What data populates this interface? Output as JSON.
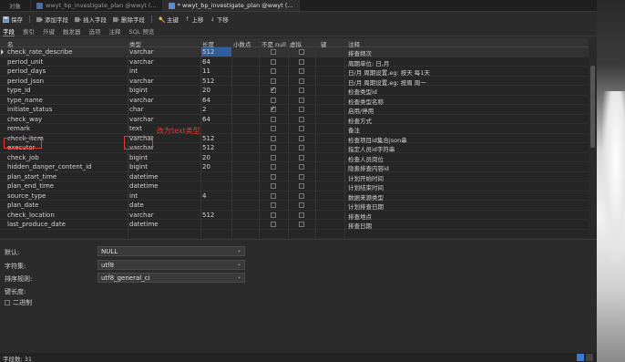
{
  "tabs": [
    {
      "label": "对象",
      "active": false
    },
    {
      "label": "wwyt_bp_investigate_plan @wwyt (...",
      "active": false
    },
    {
      "label": "* wwyt_bp_investigate_plan @wwyt (...",
      "active": true
    }
  ],
  "toolbar": {
    "save": "保存",
    "add_field": "添加字段",
    "insert_field": "插入字段",
    "delete_field": "删除字段",
    "primary_key": "主键",
    "move_up": "上移",
    "move_down": "下移"
  },
  "subtabs": [
    "字段",
    "索引",
    "外键",
    "触发器",
    "选项",
    "注释",
    "SQL 预览"
  ],
  "grid": {
    "headers": {
      "name": "名",
      "type": "类型",
      "length": "长度",
      "decimal": "小数点",
      "not_null": "不是 null",
      "virtual": "虚拟",
      "key": "键",
      "comment": "注释"
    },
    "rows": [
      {
        "name": "check_rate_describe",
        "type": "varchar",
        "length": "512",
        "not_null": false,
        "comment": "排查频次"
      },
      {
        "name": "period_unit",
        "type": "varchar",
        "length": "64",
        "not_null": false,
        "comment": "周期单位: 日,月"
      },
      {
        "name": "period_days",
        "type": "int",
        "length": "11",
        "not_null": false,
        "comment": "日/月 周期设置,eg: 按天 每1天"
      },
      {
        "name": "period_json",
        "type": "varchar",
        "length": "512",
        "not_null": false,
        "comment": "日/月 周期设置,eg: 按周 周一"
      },
      {
        "name": "type_id",
        "type": "bigint",
        "length": "20",
        "not_null": true,
        "comment": "检查类型id"
      },
      {
        "name": "type_name",
        "type": "varchar",
        "length": "64",
        "not_null": false,
        "comment": "检查类型名称"
      },
      {
        "name": "initiate_status",
        "type": "char",
        "length": "2",
        "not_null": true,
        "comment": "启用/停用"
      },
      {
        "name": "check_way",
        "type": "varchar",
        "length": "64",
        "not_null": false,
        "comment": "检查方式"
      },
      {
        "name": "remark",
        "type": "text",
        "length": "",
        "not_null": false,
        "comment": "备注"
      },
      {
        "name": "check_item",
        "type": "varchar",
        "length": "512",
        "not_null": false,
        "comment": "检查项目id集合json串"
      },
      {
        "name": "executor",
        "type": "varchar",
        "length": "512",
        "not_null": false,
        "comment": "指定人员id字符串"
      },
      {
        "name": "check_job",
        "type": "bigint",
        "length": "20",
        "not_null": false,
        "comment": "检查人员岗位"
      },
      {
        "name": "hidden_danger_content_id",
        "type": "bigint",
        "length": "20",
        "not_null": false,
        "comment": "隐患排查内容id"
      },
      {
        "name": "plan_start_time",
        "type": "datetime",
        "length": "",
        "not_null": false,
        "comment": "计划开始时间"
      },
      {
        "name": "plan_end_time",
        "type": "datetime",
        "length": "",
        "not_null": false,
        "comment": "计划结束时间"
      },
      {
        "name": "source_type",
        "type": "int",
        "length": "4",
        "not_null": false,
        "comment": "数据来源类型"
      },
      {
        "name": "plan_date",
        "type": "date",
        "length": "",
        "not_null": false,
        "comment": "计划排查日期"
      },
      {
        "name": "check_location",
        "type": "varchar",
        "length": "512",
        "not_null": false,
        "comment": "排查地点"
      },
      {
        "name": "last_produce_date",
        "type": "datetime",
        "length": "",
        "not_null": false,
        "comment": "排查日期"
      }
    ]
  },
  "annotation": "改为text类型",
  "properties": {
    "default_label": "默认:",
    "default_value": "NULL",
    "charset_label": "字符集:",
    "charset_value": "utf8",
    "collation_label": "排序规则:",
    "collation_value": "utf8_general_ci",
    "key_length_label": "键长度:",
    "binary_label": "二进制"
  },
  "status": {
    "field_count": "字段数: 31"
  }
}
